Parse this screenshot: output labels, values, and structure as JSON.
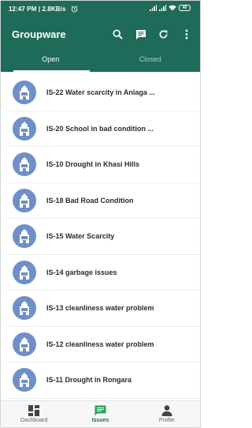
{
  "status_bar": {
    "time_and_speed": "12:47 PM | 2.8KB/s",
    "alarm_icon": "alarm-clock-icon",
    "battery": "40"
  },
  "app_bar": {
    "title": "Groupware",
    "actions": [
      "search-icon",
      "message-icon",
      "refresh-icon",
      "more-vert-icon"
    ]
  },
  "tabs": [
    {
      "label": "Open",
      "selected": true
    },
    {
      "label": "Closed",
      "selected": false
    }
  ],
  "issues": [
    {
      "title": "IS-22 Water scarcity in Aniaga ..."
    },
    {
      "title": "IS-20 School in bad condition ..."
    },
    {
      "title": "IS-10 Drought in Khasi Hills"
    },
    {
      "title": "IS-18 Bad Road Condition"
    },
    {
      "title": "IS-15 Water Scarcity"
    },
    {
      "title": "IS-14 garbage issues"
    },
    {
      "title": "IS-13 cleanliness water problem"
    },
    {
      "title": "IS-12 cleanliness water problem"
    },
    {
      "title": "IS-11 Drought in Rongara"
    }
  ],
  "bottom_nav": [
    {
      "label": "Dashboard",
      "icon": "dashboard-icon",
      "selected": false
    },
    {
      "label": "Issues",
      "icon": "issues-icon",
      "selected": true
    },
    {
      "label": "Profile",
      "icon": "profile-icon",
      "selected": false
    }
  ],
  "colors": {
    "primary": "#1e6b59",
    "avatar": "#6f8fc9"
  }
}
